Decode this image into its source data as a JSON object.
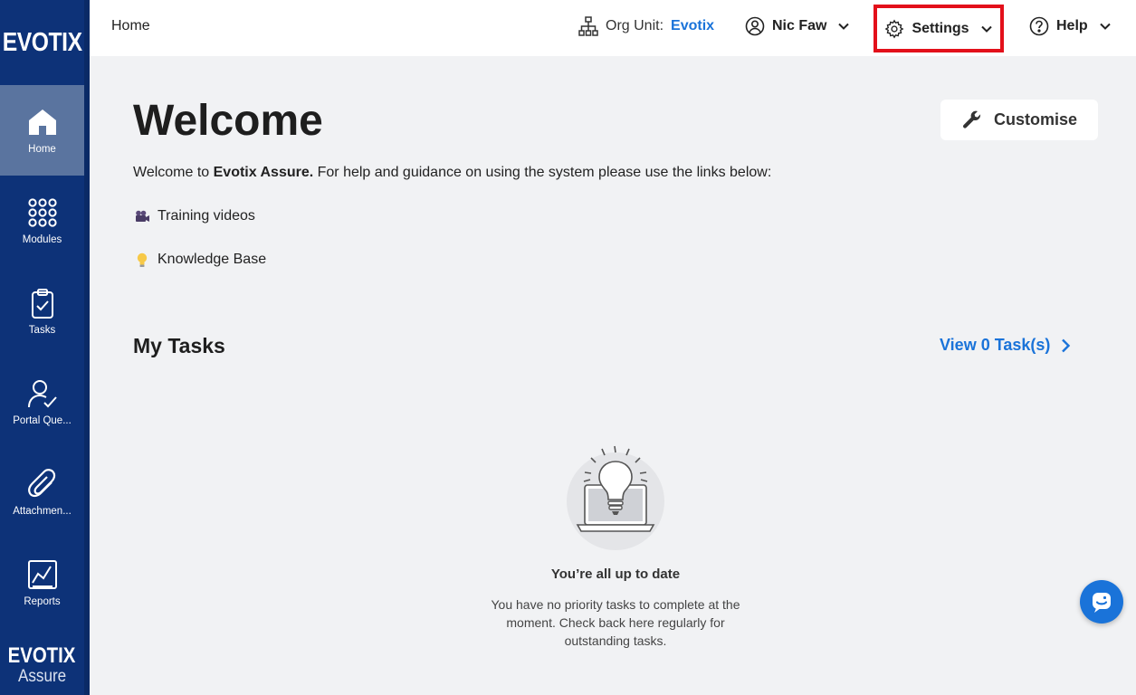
{
  "brand": {
    "logo": "EVOTIX",
    "bottom_logo_top": "EVOTIX",
    "bottom_logo_bottom": "Assure"
  },
  "sidebar": {
    "items": [
      {
        "label": "Home",
        "icon": "home-icon",
        "active": true
      },
      {
        "label": "Modules",
        "icon": "grid-dots-icon"
      },
      {
        "label": "Tasks",
        "icon": "clipboard-check-icon"
      },
      {
        "label": "Portal Que...",
        "icon": "user-check-icon"
      },
      {
        "label": "Attachmen...",
        "icon": "paperclip-icon"
      },
      {
        "label": "Reports",
        "icon": "chart-icon"
      }
    ]
  },
  "header": {
    "breadcrumb": "Home",
    "org_unit_label": "Org Unit:",
    "org_unit_value": "Evotix",
    "user_name": "Nic Faw",
    "settings_label": "Settings",
    "help_label": "Help"
  },
  "main": {
    "title": "Welcome",
    "customise_label": "Customise",
    "intro_prefix": "Welcome to ",
    "intro_brand": "Evotix Assure.",
    "intro_suffix": " For help and guidance on using the system please use the links below:",
    "links": [
      {
        "label": "Training videos",
        "icon": "video-camera-icon"
      },
      {
        "label": "Knowledge Base",
        "icon": "lightbulb-icon"
      }
    ],
    "tasks_title": "My Tasks",
    "view_tasks_label": "View 0 Task(s)",
    "empty_title": "You’re all up to date",
    "empty_desc": "You have no priority tasks to complete at the moment. Check back here regularly for outstanding tasks."
  },
  "colors": {
    "sidebar": "#0d3278",
    "active": "#5a749f",
    "accent": "#1a73d9",
    "highlight": "#e3101a"
  }
}
